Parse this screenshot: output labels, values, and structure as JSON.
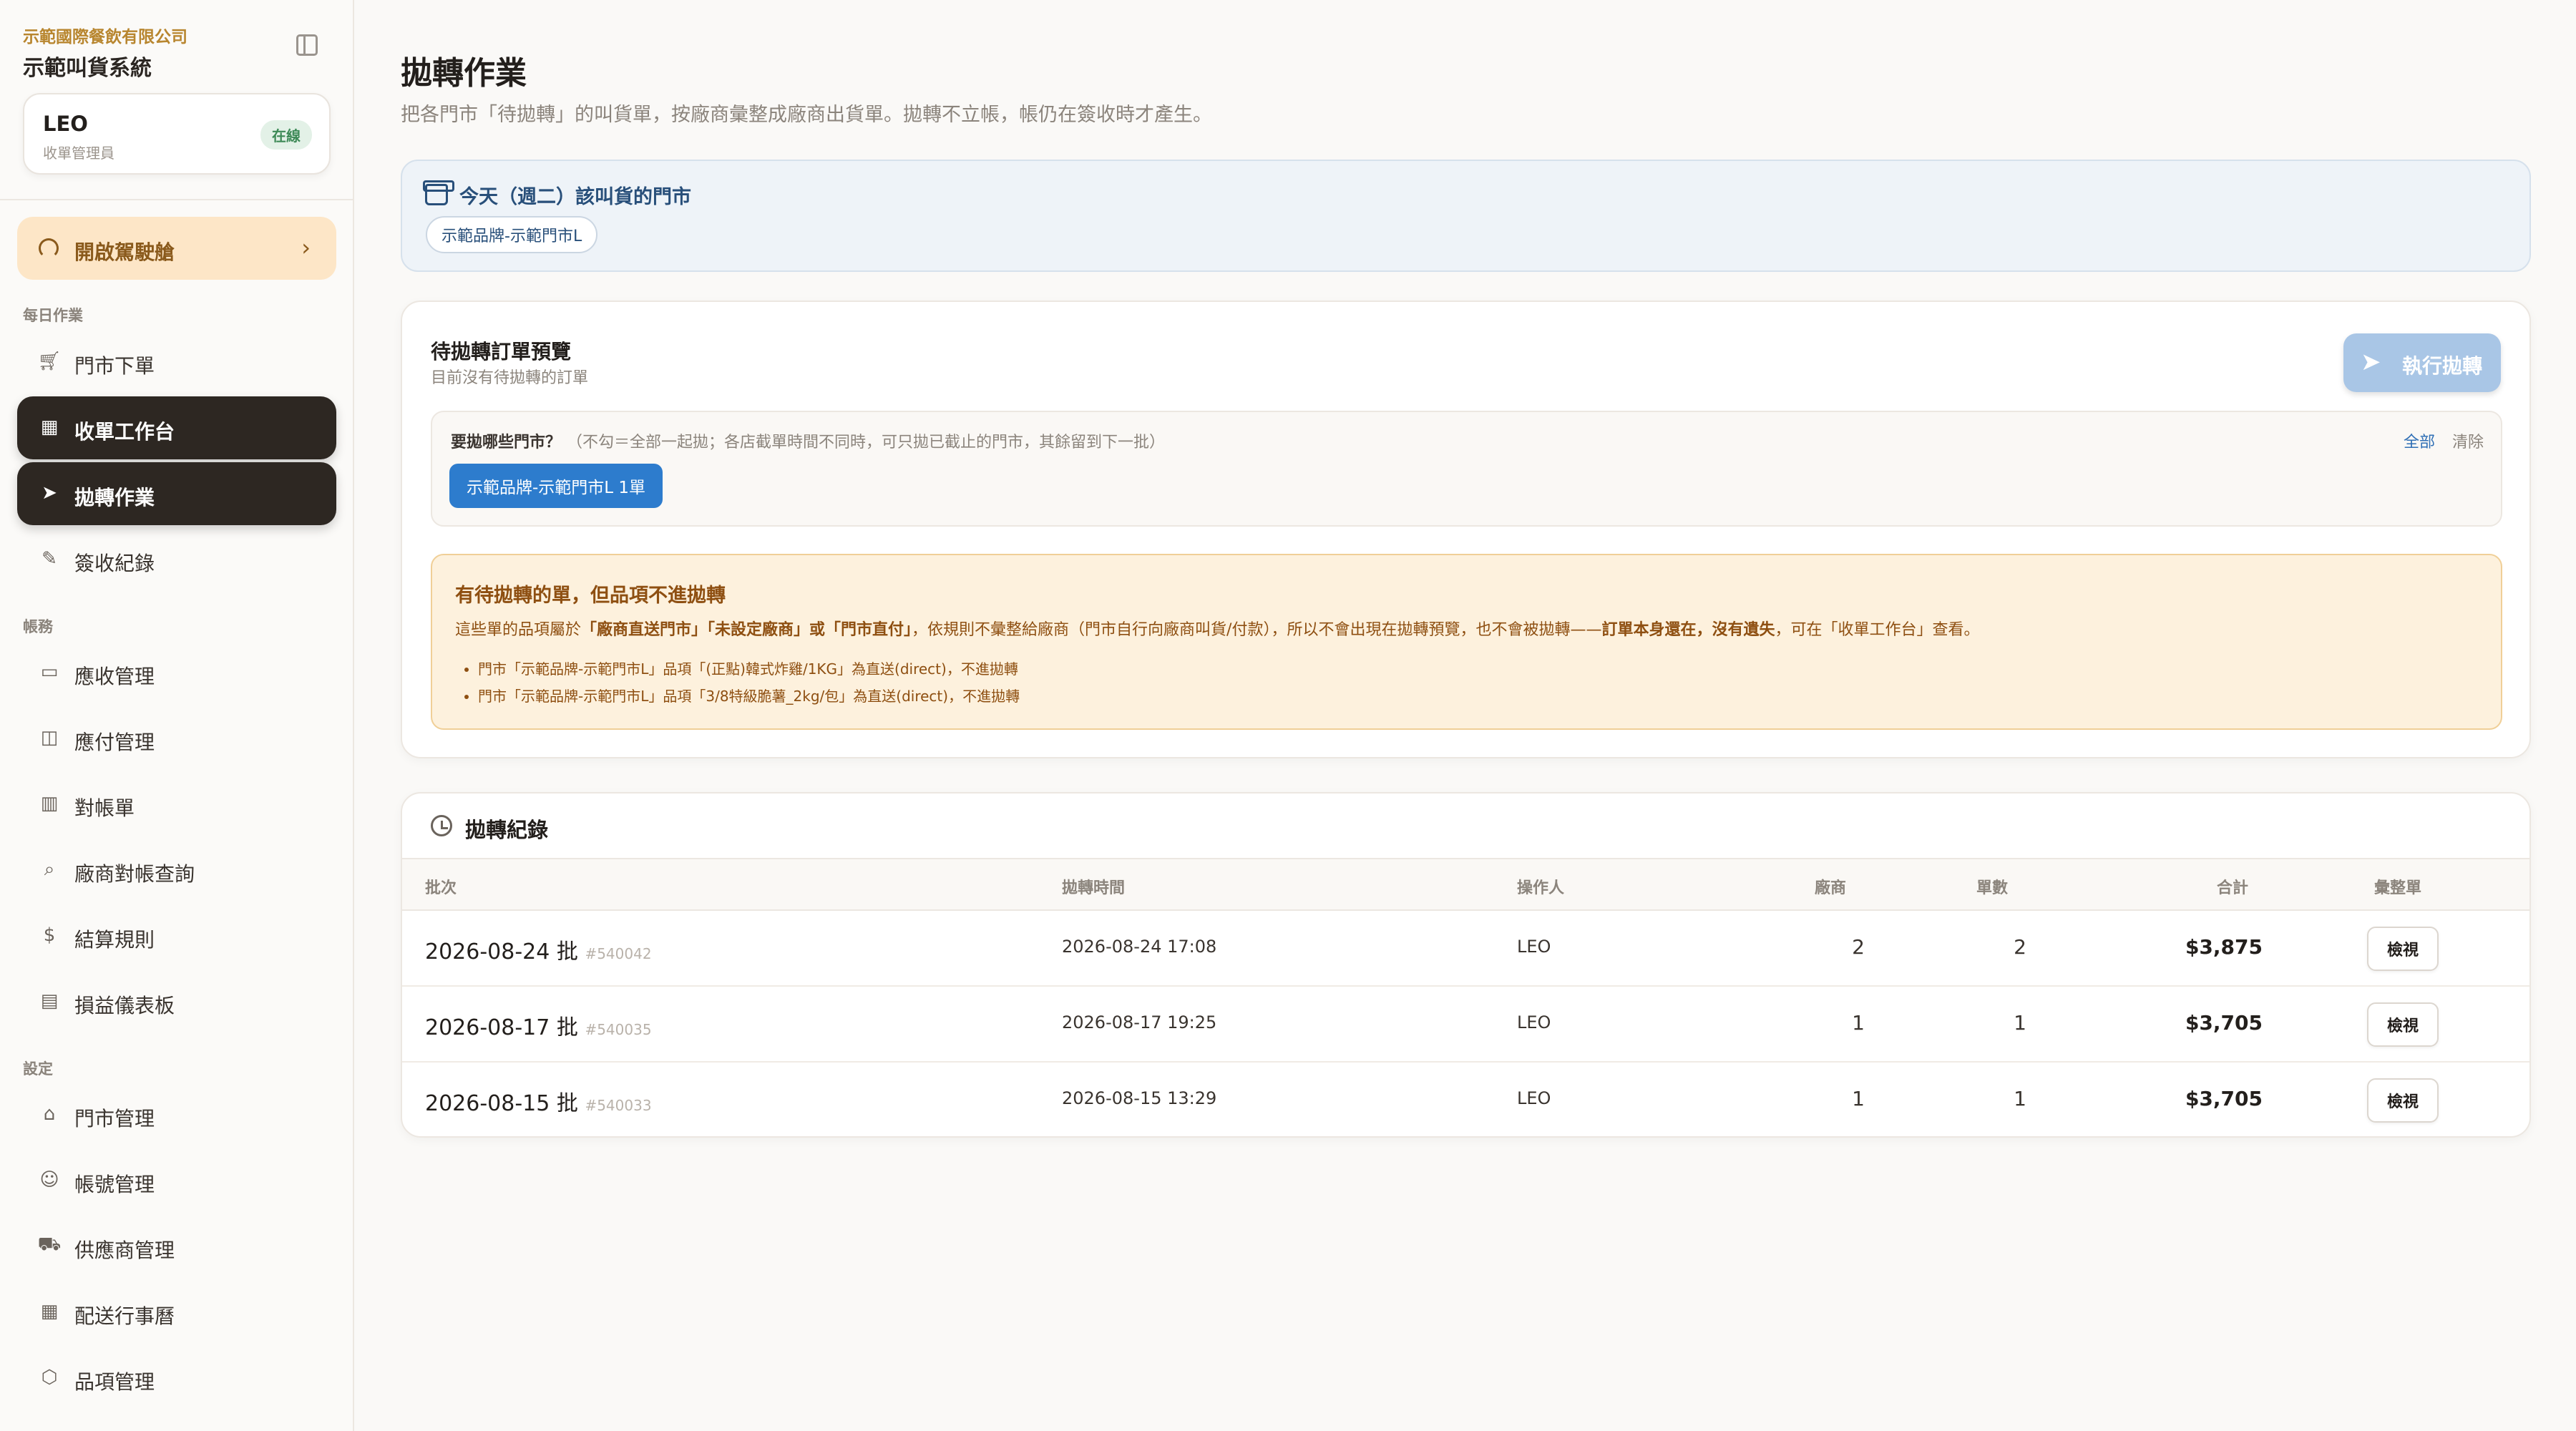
{
  "sidebar": {
    "company": "示範國際餐飲有限公司",
    "app_name": "示範叫貨系統",
    "user": {
      "name": "LEO",
      "role": "收單管理員",
      "status": "在線"
    },
    "dashboard_button": "開啟駕駛艙",
    "sections": [
      {
        "label": "每日作業",
        "items": [
          {
            "label": "門市下單",
            "icon": "cart-icon"
          },
          {
            "label": "收單工作台",
            "icon": "grid-icon"
          },
          {
            "label": "拋轉作業",
            "icon": "send-icon"
          },
          {
            "label": "簽收紀錄",
            "icon": "edit-doc-icon"
          }
        ]
      },
      {
        "label": "帳務",
        "items": [
          {
            "label": "應收管理",
            "icon": "card-icon"
          },
          {
            "label": "應付管理",
            "icon": "wallet-icon"
          },
          {
            "label": "對帳單",
            "icon": "bar-chart-icon"
          },
          {
            "label": "廠商對帳查詢",
            "icon": "doc-search-icon"
          },
          {
            "label": "結算規則",
            "icon": "receipt-icon"
          },
          {
            "label": "損益儀表板",
            "icon": "chart-icon"
          }
        ]
      },
      {
        "label": "設定",
        "items": [
          {
            "label": "門市管理",
            "icon": "store-icon"
          },
          {
            "label": "帳號管理",
            "icon": "users-icon"
          },
          {
            "label": "供應商管理",
            "icon": "truck-icon"
          },
          {
            "label": "配送行事曆",
            "icon": "calendar-icon"
          },
          {
            "label": "品項管理",
            "icon": "box-icon"
          }
        ]
      }
    ]
  },
  "main": {
    "title": "拋轉作業",
    "subtitle": "把各門市「待拋轉」的叫貨單，按廠商彙整成廠商出貨單。拋轉不立帳，帳仍在簽收時才產生。",
    "today": {
      "title": "今天（週二）該叫貨的門市",
      "store": "示範品牌-示範門市L"
    },
    "preview": {
      "title": "待拋轉訂單預覽",
      "subtitle": "目前沒有待拋轉的訂單",
      "execute_button": "執行拋轉",
      "filter_question": "要拋哪些門市？",
      "filter_hint": "（不勾＝全部一起拋；各店截單時間不同時，可只拋已截止的門市，其餘留到下一批）",
      "filter_all": "全部",
      "filter_clear": "清除",
      "store_pill": "示範品牌-示範門市L 1單"
    },
    "warning": {
      "title": "有待拋轉的單，但品項不進拋轉",
      "body_prefix": "這些單的品項屬於",
      "body_bold1": "「廠商直送門市」「未設定廠商」或「門市直付」",
      "body_mid": "，依規則不彙整給廠商（門市自行向廠商叫貨/付款），所以不會出現在拋轉預覽，也不會被拋轉——",
      "body_bold2": "訂單本身還在，沒有遺失",
      "body_suffix": "，可在「收單工作台」查看。",
      "items": [
        "門市「示範品牌-示範門市L」品項「(正點)韓式炸雞/1KG」為直送(direct)，不進拋轉",
        "門市「示範品牌-示範門市L」品項「3/8特級脆薯_2kg/包」為直送(direct)，不進拋轉"
      ]
    },
    "history": {
      "title": "拋轉紀錄",
      "columns": [
        "批次",
        "拋轉時間",
        "操作人",
        "廠商",
        "單數",
        "合計",
        "彙整單"
      ],
      "rows": [
        {
          "batch": "2026-08-24 批",
          "id": "#540042",
          "time": "2026-08-24 17:08",
          "operator": "LEO",
          "vendors": "2",
          "orders": "2",
          "total": "$3,875",
          "action": "檢視"
        },
        {
          "batch": "2026-08-17 批",
          "id": "#540035",
          "time": "2026-08-17 19:25",
          "operator": "LEO",
          "vendors": "1",
          "orders": "1",
          "total": "$3,705",
          "action": "檢視"
        },
        {
          "batch": "2026-08-15 批",
          "id": "#540033",
          "time": "2026-08-15 13:29",
          "operator": "LEO",
          "vendors": "1",
          "orders": "1",
          "total": "$3,705",
          "action": "檢視"
        }
      ]
    }
  }
}
